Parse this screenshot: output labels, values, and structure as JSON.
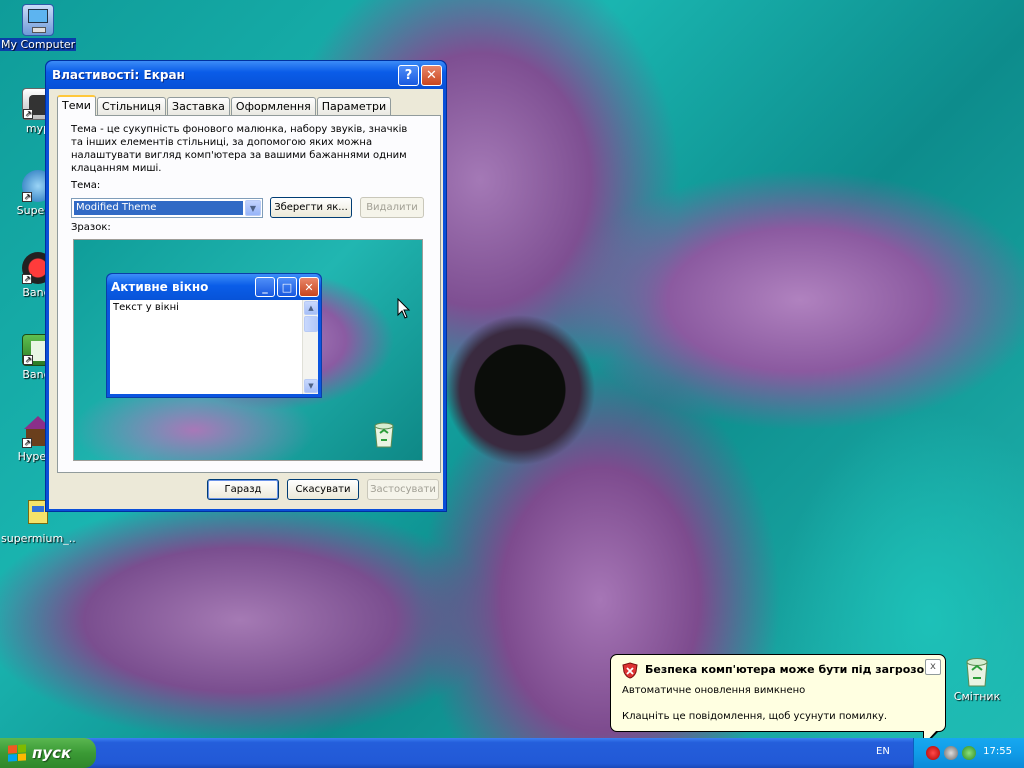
{
  "desktop": {
    "icons": [
      {
        "label": "My Computer"
      },
      {
        "label": "myp"
      },
      {
        "label": "Superm"
      },
      {
        "label": "Bandi"
      },
      {
        "label": "Bandi"
      },
      {
        "label": "HyperC"
      },
      {
        "label": "supermium_..."
      }
    ],
    "recycle_bin": {
      "label": "Смітник"
    }
  },
  "dialog": {
    "title": "Властивості: Екран",
    "help_label": "?",
    "close_label": "✕",
    "tabs": [
      "Теми",
      "Стільниця",
      "Заставка",
      "Оформлення",
      "Параметри"
    ],
    "active_tab": "Теми",
    "description": "Тема - це сукупність фонового малюнка, набору звуків, значків та інших елементів стільниці, за допомогою яких можна налаштувати вигляд комп'ютера за вашими бажаннями одним клацанням миші.",
    "theme_label": "Тема:",
    "theme_value": "Modified Theme",
    "save_as_label": "Зберегти як...",
    "delete_label": "Видалити",
    "sample_label": "Зразок:",
    "preview": {
      "window_title": "Активне вікно",
      "window_text": "Текст у вікні"
    },
    "ok_label": "Гаразд",
    "cancel_label": "Скасувати",
    "apply_label": "Застосувати"
  },
  "taskbar": {
    "start_label": "пуск",
    "language": "EN",
    "clock": "17:55"
  },
  "balloon": {
    "title": "Безпека комп'ютера може бути під загрозою",
    "line1": "Автоматичне оновлення вимкнено",
    "line2": "Клацніть це повідомлення, щоб усунути помилку.",
    "close_label": "x"
  },
  "colors": {
    "titlebar_blue": "#0a5ce8",
    "dialog_face": "#ece9d8",
    "selection_blue": "#316ac5",
    "start_green": "#3b9a35",
    "balloon_bg": "#ffffe1",
    "active_tab_highlight": "#ffc83c"
  }
}
